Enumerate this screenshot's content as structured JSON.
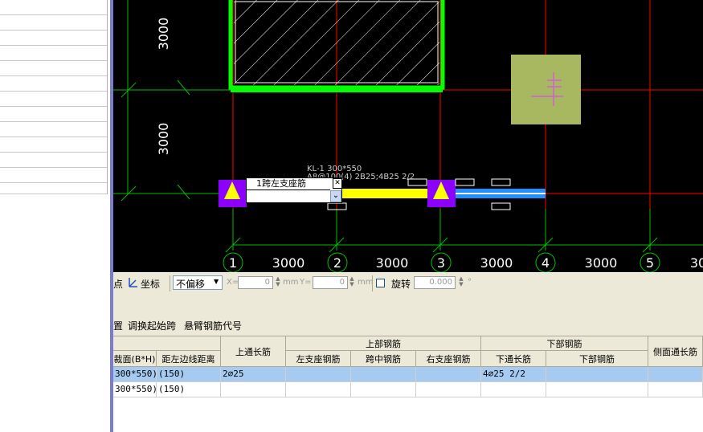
{
  "canvas": {
    "dims_left": [
      "3000",
      "3000"
    ],
    "dims_bottom": [
      "3000",
      "3000",
      "3000",
      "3000",
      "30"
    ],
    "axes": [
      "1",
      "2",
      "3",
      "4",
      "5"
    ],
    "beam_label_line1": "KL-1 300*550",
    "beam_label_line2": "A8@100(4) 2B25;4B25 2/2",
    "popup_title": "1跨左支座筋",
    "popup_close": "✕",
    "popup_dropdown": "⌄",
    "colors": {
      "beam": "#ffff00",
      "bar": "#1e90ff",
      "column": "#8b00ff",
      "slab": "#00ff00",
      "grid": "#ff0000",
      "axis": "#00ff00"
    }
  },
  "toolbar": {
    "point_label": "点",
    "coord_label": "坐标",
    "offset_select": "不偏移",
    "x_label": "X=",
    "x_value": "0",
    "y_label": "Y=",
    "y_value": "0",
    "unit": "mm",
    "rotate_label": "旋转",
    "rotate_value": "0.000",
    "degree": "°"
  },
  "toolbar3": {
    "item1": "置",
    "item2": "调换起始跨",
    "item3": "悬臂钢筋代号"
  },
  "table": {
    "headers": {
      "section": "裁面(B*H)",
      "edge_dist": "距左边线距离",
      "top_through": "上通长筋",
      "top_group": "上部钢筋",
      "left_support": "左支座钢筋",
      "mid_span": "跨中钢筋",
      "right_support": "右支座钢筋",
      "bottom_group": "下部钢筋",
      "bottom_through": "下通长筋",
      "bottom_bars": "下部钢筋",
      "side_through": "侧面通长筋"
    },
    "rows": [
      {
        "section": "300*550)",
        "edge_dist": "(150)",
        "top_through": "2⌀25",
        "bottom_through": "4⌀25 2/2"
      },
      {
        "section": "300*550)",
        "edge_dist": "(150)",
        "top_through": "",
        "bottom_through": ""
      }
    ]
  }
}
